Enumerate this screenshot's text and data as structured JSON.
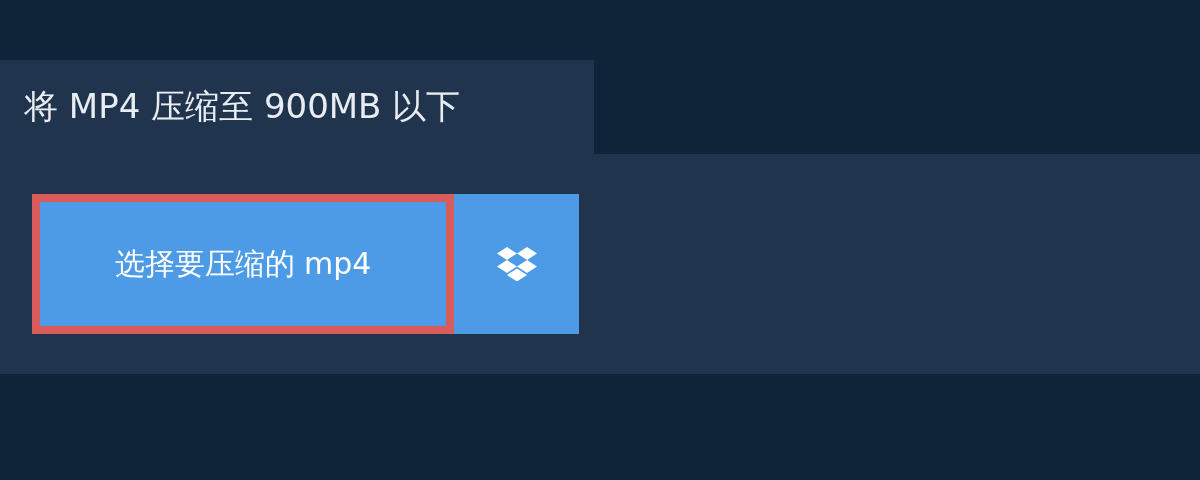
{
  "title": "将 MP4 压缩至 900MB 以下",
  "upload_button": {
    "label": "选择要压缩的 mp4",
    "focused": true
  }
}
